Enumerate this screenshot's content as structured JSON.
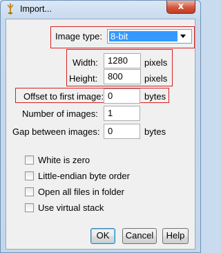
{
  "window": {
    "title": "Import...",
    "close_glyph": "x"
  },
  "form": {
    "image_type": {
      "label": "Image type:",
      "value": "8-bit"
    },
    "width": {
      "label": "Width:",
      "value": "1280",
      "unit": "pixels"
    },
    "height": {
      "label": "Height:",
      "value": "800",
      "unit": "pixels"
    },
    "offset": {
      "label": "Offset to first image:",
      "value": "0",
      "unit": "bytes"
    },
    "num_images": {
      "label": "Number of images:",
      "value": "1"
    },
    "gap": {
      "label": "Gap between images:",
      "value": "0",
      "unit": "bytes"
    }
  },
  "options": [
    {
      "label": "White is zero",
      "checked": false
    },
    {
      "label": "Little-endian byte order",
      "checked": false
    },
    {
      "label": "Open all files in folder",
      "checked": false
    },
    {
      "label": "Use virtual stack",
      "checked": false
    }
  ],
  "buttons": {
    "ok": "OK",
    "cancel": "Cancel",
    "help": "Help"
  },
  "colors": {
    "highlight_box": "#d62020",
    "selection": "#3399ff",
    "close_button": "#c7442a"
  }
}
